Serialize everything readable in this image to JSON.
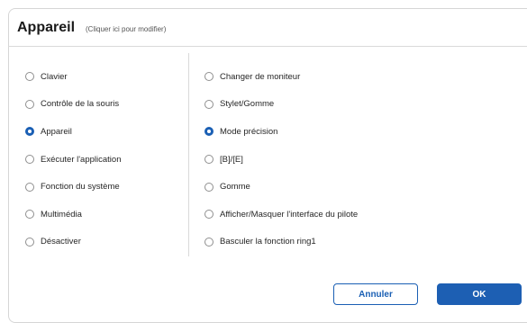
{
  "dialog": {
    "title": "Appareil",
    "subtitle": "(Cliquer ici pour modifier)"
  },
  "left_options": [
    {
      "label": "Clavier",
      "selected": false
    },
    {
      "label": "Contrôle de la souris",
      "selected": false
    },
    {
      "label": "Appareil",
      "selected": true
    },
    {
      "label": "Exécuter l'application",
      "selected": false
    },
    {
      "label": "Fonction du système",
      "selected": false
    },
    {
      "label": "Multimédia",
      "selected": false
    },
    {
      "label": "Désactiver",
      "selected": false
    }
  ],
  "right_options": [
    {
      "label": "Changer de moniteur",
      "selected": false
    },
    {
      "label": "Stylet/Gomme",
      "selected": false
    },
    {
      "label": "Mode précision",
      "selected": true
    },
    {
      "label": "[B]/[E]",
      "selected": false
    },
    {
      "label": "Gomme",
      "selected": false
    },
    {
      "label": "Afficher/Masquer l'interface du pilote",
      "selected": false
    },
    {
      "label": "Basculer la fonction ring1",
      "selected": false
    }
  ],
  "buttons": {
    "cancel": "Annuler",
    "ok": "OK"
  },
  "colors": {
    "accent": "#1d5fb3",
    "border": "#d6d6d6"
  }
}
